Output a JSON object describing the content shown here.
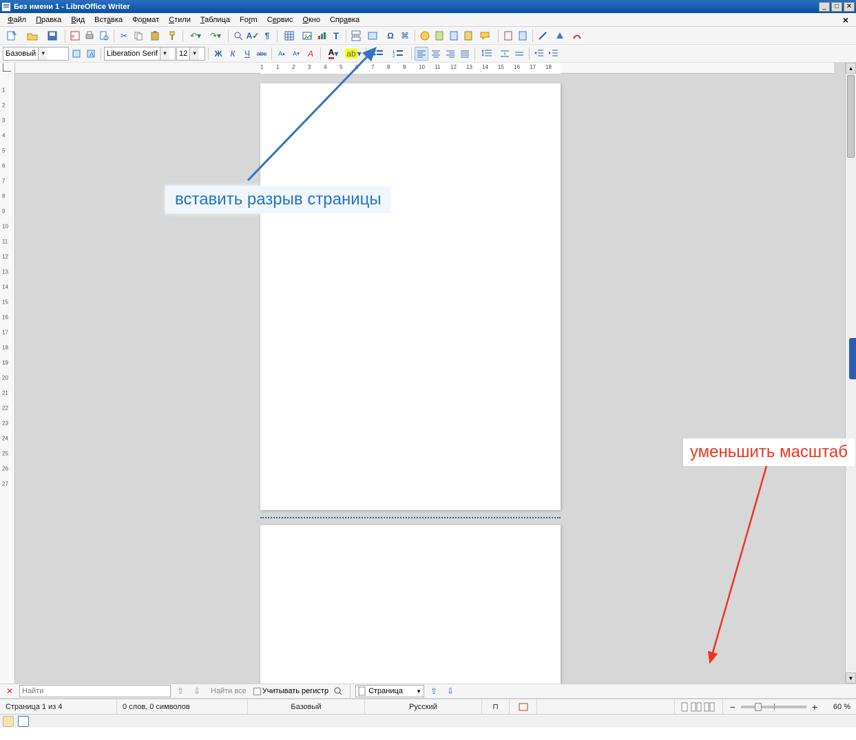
{
  "title": "Без имени 1 - LibreOffice Writer",
  "menu": {
    "file": "Файл",
    "edit": "Правка",
    "view": "Вид",
    "insert": "Вставка",
    "format": "Формат",
    "styles": "Стили",
    "table": "Таблица",
    "form": "Form",
    "tools": "Сервис",
    "window": "Окно",
    "help": "Справка"
  },
  "formatbar": {
    "style": "Базовый",
    "font": "Liberation Serif",
    "size": "12",
    "bold": "Ж",
    "italic": "К",
    "underline": "Ч",
    "strike": "abc"
  },
  "ruler_h": [
    "1",
    "1",
    "2",
    "3",
    "4",
    "5",
    "6",
    "7",
    "8",
    "9",
    "10",
    "11",
    "12",
    "13",
    "14",
    "15",
    "16",
    "17",
    "18"
  ],
  "ruler_v": [
    "1",
    "2",
    "3",
    "4",
    "5",
    "6",
    "7",
    "8",
    "9",
    "10",
    "11",
    "12",
    "13",
    "14",
    "15",
    "16",
    "17",
    "18",
    "19",
    "20",
    "21",
    "22",
    "23",
    "24",
    "25",
    "26",
    "27"
  ],
  "annotations": {
    "insert_break": "вставить разрыв страницы",
    "zoom_out": "уменьшить масштаб"
  },
  "findbar": {
    "close": "✕",
    "placeholder": "Найти",
    "find_all": "Найти все",
    "match_case": "Учитывать регистр",
    "nav_label": "Страница"
  },
  "status": {
    "page": "Страница 1 из 4",
    "words": "0 слов, 0 символов",
    "style": "Базовый",
    "lang": "Русский",
    "zoom": "60 %",
    "minus": "−",
    "plus": "+"
  }
}
